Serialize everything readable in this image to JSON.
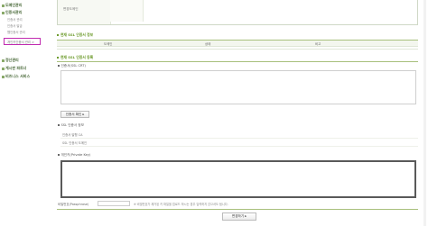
{
  "sidebar": {
    "sections": [
      {
        "label": "도메인관리"
      },
      {
        "label": "인증서관리"
      }
    ],
    "sub_items": [
      {
        "label": "인증서 관리"
      },
      {
        "label": "인증서 발급"
      },
      {
        "label": "웹인증서 관리"
      }
    ],
    "active_item": {
      "label": "개인키인증서 관리 >"
    },
    "bottom_sections": [
      {
        "label": "정산관리"
      },
      {
        "label": "게시판 파트너"
      },
      {
        "label": "비즈니스 서비스"
      }
    ]
  },
  "top_box": {
    "label": "변경도메인"
  },
  "ssl_info": {
    "title": "현재 SSL 인증서 정보",
    "columns": [
      "도메인",
      "상태",
      "비고"
    ]
  },
  "ssl_register": {
    "title": "현재 SSL 인증서 등록",
    "cert_label": "인증서(SSL CRT)",
    "verify_button": "인증서 확인 ▸",
    "info_label": "SSL 인증서 정보",
    "info_rows": [
      "인증서 발행 CA",
      "SSL 인증서 도메인"
    ],
    "key_label": "개인키(Private Key)",
    "password_label": "비밀번호(Passphrase)",
    "password_note": "※ 비밀번호가 제거된 키 파일을 업로드 하시는 경우 입력하지 않으셔도 됩니다.",
    "submit_button": "변경하기 ▸"
  }
}
